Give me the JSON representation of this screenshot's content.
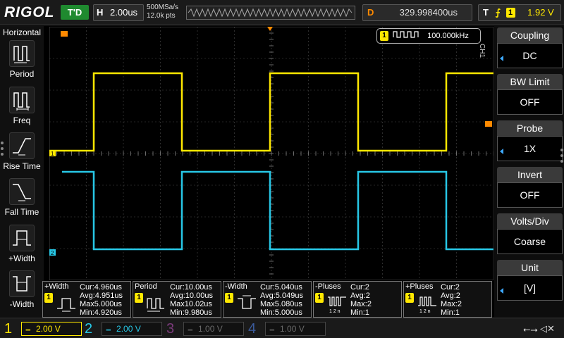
{
  "topbar": {
    "logo": "RIGOL",
    "status": "T'D",
    "timebase_label": "H",
    "timebase": "2.00us",
    "sample_rate": "500MSa/s",
    "mem_depth": "12.0k pts",
    "delay_label": "D",
    "delay": "329.998400us",
    "trig_label": "T",
    "trig_edge": "⨍",
    "trig_source": "1",
    "trig_level": "1.92 V"
  },
  "left_menu": {
    "title": "Horizontal",
    "items": [
      {
        "label": "Period",
        "icon": "period-icon"
      },
      {
        "label": "Freq",
        "icon": "freq-icon"
      },
      {
        "label": "Rise Time",
        "icon": "rise-time-icon"
      },
      {
        "label": "Fall Time",
        "icon": "fall-time-icon"
      },
      {
        "label": "+Width",
        "icon": "pos-width-icon"
      },
      {
        "label": "-Width",
        "icon": "neg-width-icon"
      }
    ]
  },
  "channel_freq": {
    "channel": "1",
    "value": "100.000kHz"
  },
  "right_menu": {
    "channel": "CH1",
    "items": [
      {
        "title": "Coupling",
        "value": "DC",
        "arrow": true
      },
      {
        "title": "BW Limit",
        "value": "OFF",
        "arrow": false
      },
      {
        "title": "Probe",
        "value": "1X",
        "arrow": true
      },
      {
        "title": "Invert",
        "value": "OFF",
        "arrow": false
      },
      {
        "title": "Volts/Div",
        "value": "Coarse",
        "arrow": false
      },
      {
        "title": "Unit",
        "value": "[V]",
        "arrow": true
      }
    ]
  },
  "measurements": [
    {
      "title": "+Width",
      "ch": "1",
      "icon": "pos-width-meas-icon",
      "cur": "Cur:4.960us",
      "avg": "Avg:4.951us",
      "max": "Max5.000us",
      "min": "Min:4.920us"
    },
    {
      "title": "Period",
      "ch": "1",
      "icon": "period-meas-icon",
      "cur": "Cur:10.00us",
      "avg": "Avg:10.00us",
      "max": "Max10.02us",
      "min": "Min:9.980us"
    },
    {
      "title": "-Width",
      "ch": "1",
      "icon": "neg-width-meas-icon",
      "cur": "Cur:5.040us",
      "avg": "Avg:5.049us",
      "max": "Max5.080us",
      "min": "Min:5.000us"
    },
    {
      "title": "-Pluses",
      "ch": "1",
      "icon": "neg-pulses-meas-icon",
      "cur": "Cur:2",
      "avg": "Avg:2",
      "max": "Max:2",
      "min": "Min:1"
    },
    {
      "title": "+Pluses",
      "ch": "1",
      "icon": "pos-pulses-meas-icon",
      "cur": "Cur:2",
      "avg": "Avg:2",
      "max": "Max:2",
      "min": "Min:1"
    }
  ],
  "channels": [
    {
      "num": "1",
      "scale": "2.00 V",
      "color": "#ffe800"
    },
    {
      "num": "2",
      "scale": "2.00 V",
      "color": "#27c7e6"
    },
    {
      "num": "3",
      "scale": "1.00 V",
      "color": "#7a3a7a"
    },
    {
      "num": "4",
      "scale": "1.00 V",
      "color": "#3a5a9a"
    }
  ],
  "icons": {
    "usb": "usb-icon",
    "speaker": "speaker-mute-icon"
  },
  "colors": {
    "ch1": "#ffe800",
    "ch2": "#27c7e6",
    "trigger": "#ff8a00",
    "grid": "#4a4a4a",
    "menu_arrow": "#3da9ff"
  }
}
